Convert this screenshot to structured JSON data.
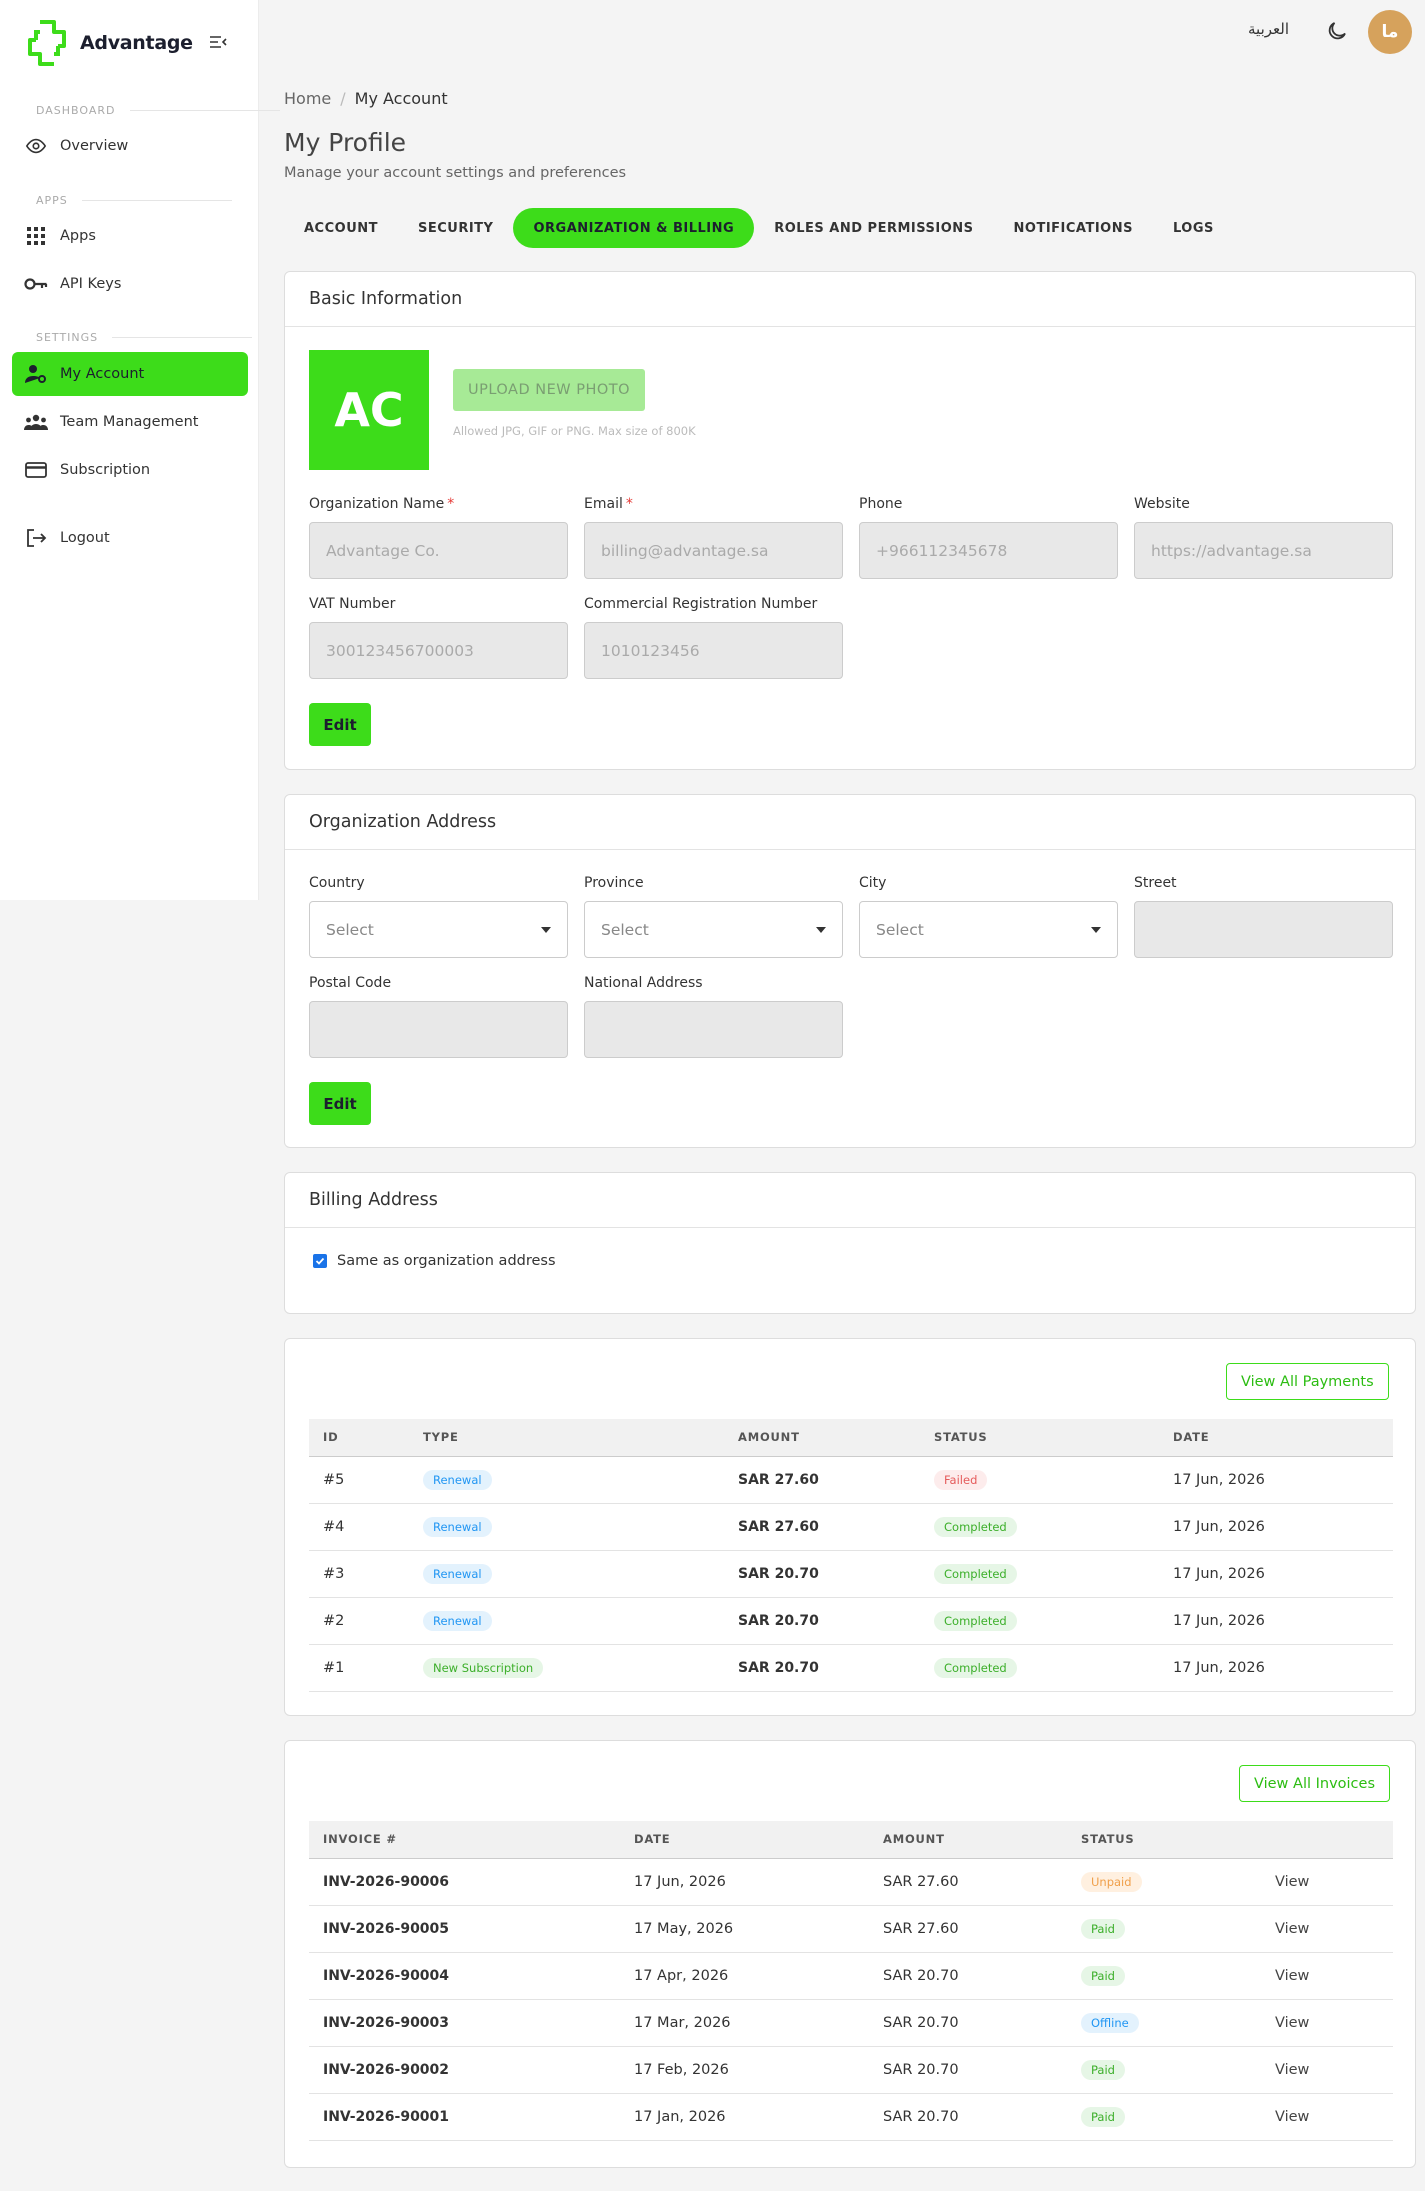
{
  "app": {
    "logo_text": "Advantage"
  },
  "sidebar": {
    "sections": [
      {
        "label": "DASHBOARD"
      },
      {
        "label": "APPS"
      },
      {
        "label": "SETTINGS"
      }
    ],
    "items": [
      {
        "label": "Overview",
        "icon": "eye-icon"
      },
      {
        "label": "Apps",
        "icon": "grid-icon"
      },
      {
        "label": "API Keys",
        "icon": "key-icon"
      },
      {
        "label": "My Account",
        "icon": "user-cog-icon",
        "active": true
      },
      {
        "label": "Team Management",
        "icon": "team-icon"
      },
      {
        "label": "Subscription",
        "icon": "card-icon"
      },
      {
        "label": "Logout",
        "icon": "logout-icon"
      }
    ]
  },
  "topbar": {
    "language": "العربية",
    "avatar_initials": "ما"
  },
  "breadcrumb": {
    "home": "Home",
    "separator": "/",
    "current": "My Account"
  },
  "page": {
    "title": "My Profile",
    "subtitle": "Manage your account settings and preferences"
  },
  "tabs": [
    {
      "label": "ACCOUNT"
    },
    {
      "label": "SECURITY"
    },
    {
      "label": "ORGANIZATION & BILLING",
      "active": true
    },
    {
      "label": "ROLES AND PERMISSIONS"
    },
    {
      "label": "NOTIFICATIONS"
    },
    {
      "label": "LOGS"
    }
  ],
  "basic_info": {
    "title": "Basic Information",
    "photo_initials": "AC",
    "upload_label": "UPLOAD NEW PHOTO",
    "upload_hint": "Allowed JPG, GIF or PNG. Max size of 800K",
    "fields": {
      "org_name": {
        "label": "Organization Name",
        "value": "Advantage Co."
      },
      "email": {
        "label": "Email",
        "value": "billing@advantage.sa"
      },
      "phone": {
        "label": "Phone",
        "value": "+966112345678"
      },
      "website": {
        "label": "Website",
        "value": "https://advantage.sa"
      },
      "vat": {
        "label": "VAT Number",
        "value": "300123456700003"
      },
      "crn": {
        "label": "Commercial Registration Number",
        "value": "1010123456"
      }
    },
    "required_mark": "*",
    "edit_label": "Edit"
  },
  "org_address": {
    "title": "Organization Address",
    "fields": {
      "country": {
        "label": "Country",
        "value": "Select"
      },
      "province": {
        "label": "Province",
        "value": "Select"
      },
      "city": {
        "label": "City",
        "value": "Select"
      },
      "street": {
        "label": "Street",
        "value": ""
      },
      "postal": {
        "label": "Postal Code",
        "value": ""
      },
      "national": {
        "label": "National Address",
        "value": ""
      }
    },
    "edit_label": "Edit"
  },
  "billing_address": {
    "title": "Billing Address",
    "same_as_label": "Same as organization address",
    "same_as_checked": true
  },
  "payments": {
    "button": "View All Payments",
    "columns": [
      "ID",
      "TYPE",
      "AMOUNT",
      "STATUS",
      "DATE"
    ],
    "rows": [
      {
        "id": "#5",
        "type": "Renewal",
        "amount": "SAR 27.60",
        "status": "Failed",
        "status_color": "red",
        "date": "17 Jun, 2026"
      },
      {
        "id": "#4",
        "type": "Renewal",
        "amount": "SAR 27.60",
        "status": "Completed",
        "status_color": "green",
        "date": "17 Jun, 2026"
      },
      {
        "id": "#3",
        "type": "Renewal",
        "amount": "SAR 20.70",
        "status": "Completed",
        "status_color": "green",
        "date": "17 Jun, 2026"
      },
      {
        "id": "#2",
        "type": "Renewal",
        "amount": "SAR 20.70",
        "status": "Completed",
        "status_color": "green",
        "date": "17 Jun, 2026"
      },
      {
        "id": "#1",
        "type": "New Subscription",
        "type_color": "green",
        "amount": "SAR 20.70",
        "status": "Completed",
        "status_color": "green",
        "date": "17 Jun, 2026"
      }
    ]
  },
  "invoices": {
    "button": "View All Invoices",
    "columns": [
      "INVOICE #",
      "DATE",
      "AMOUNT",
      "STATUS",
      ""
    ],
    "rows": [
      {
        "invoice": "INV-2026-90006",
        "date": "17 Jun, 2026",
        "amount": "SAR 27.60",
        "status": "Unpaid",
        "status_color": "orange",
        "action": "View"
      },
      {
        "invoice": "INV-2026-90005",
        "date": "17 May, 2026",
        "amount": "SAR 27.60",
        "status": "Paid",
        "status_color": "green",
        "action": "View"
      },
      {
        "invoice": "INV-2026-90004",
        "date": "17 Apr, 2026",
        "amount": "SAR 20.70",
        "status": "Paid",
        "status_color": "green",
        "action": "View"
      },
      {
        "invoice": "INV-2026-90003",
        "date": "17 Mar, 2026",
        "amount": "SAR 20.70",
        "status": "Offline",
        "status_color": "blue",
        "action": "View"
      },
      {
        "invoice": "INV-2026-90002",
        "date": "17 Feb, 2026",
        "amount": "SAR 20.70",
        "status": "Paid",
        "status_color": "green",
        "action": "View"
      },
      {
        "invoice": "INV-2026-90001",
        "date": "17 Jan, 2026",
        "amount": "SAR 20.70",
        "status": "Paid",
        "status_color": "green",
        "action": "View"
      }
    ]
  },
  "colors": {
    "accent": "#3ddc1a",
    "avatar": "#d6a25c",
    "checkbox": "#1a73e8"
  }
}
